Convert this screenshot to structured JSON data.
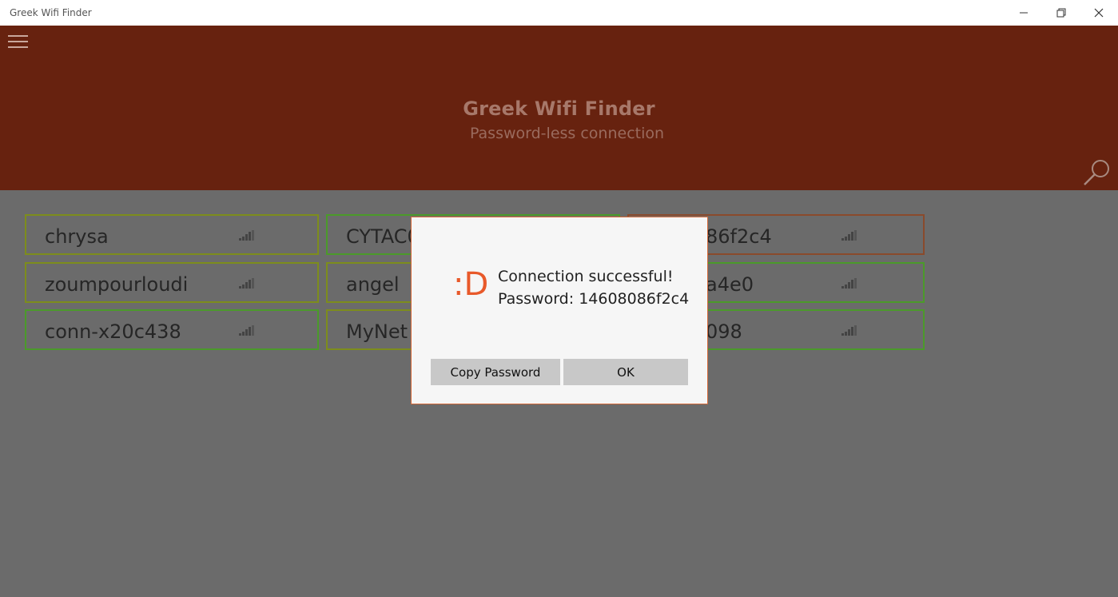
{
  "window": {
    "title": "Greek Wifi Finder"
  },
  "header": {
    "title": "Greek Wifi Finder",
    "subtitle": "Password-less connection"
  },
  "networks": [
    {
      "ssid": "chrysa"
    },
    {
      "ssid": "CYTAC0"
    },
    {
      "ssid": "86f2c4"
    },
    {
      "ssid": "zoumpourloudi"
    },
    {
      "ssid": "angel"
    },
    {
      "ssid": "a4e0"
    },
    {
      "ssid": "conn-x20c438"
    },
    {
      "ssid": "MyNet"
    },
    {
      "ssid": "098"
    }
  ],
  "dialog": {
    "emoticon": ":D",
    "message": "Connection successful!",
    "password_line": "Password: 14608086f2c4",
    "copy_button": "Copy Password",
    "ok_button": "OK"
  },
  "colors": {
    "header_bg": "#67220f",
    "accent": "#e8592a",
    "overlay_bg": "#6b6b6b"
  }
}
